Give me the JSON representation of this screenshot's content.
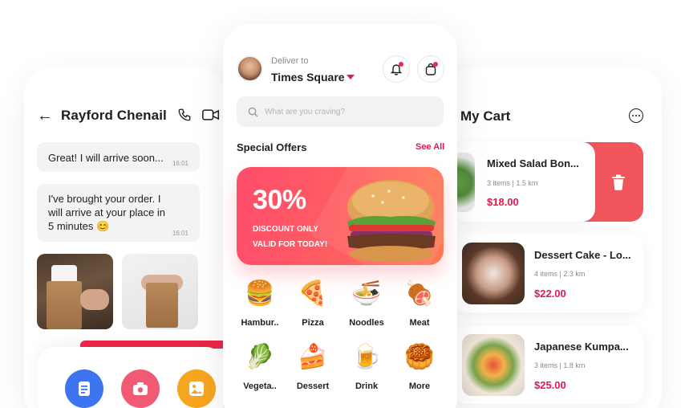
{
  "chat": {
    "contact_name": "Rayford Chenail",
    "messages": [
      {
        "text": "Great! I will arrive soon...",
        "time": "16:01"
      },
      {
        "text": "I've brought your order. I will arrive at your place in 5 minutes 😊",
        "time": "16:01"
      }
    ],
    "icons": {
      "back": "back-arrow-icon",
      "call": "phone-icon",
      "video": "video-camera-icon",
      "doc": "document-icon",
      "camera": "camera-icon",
      "image": "image-icon"
    }
  },
  "home": {
    "deliver_label": "Deliver to",
    "location": "Times Square",
    "search_placeholder": "What are you craving?",
    "offers_title": "Special Offers",
    "see_all": "See All",
    "offer": {
      "percent": "30%",
      "line": "DISCOUNT ONLY VALID FOR TODAY!"
    },
    "categories": [
      {
        "emoji": "🍔",
        "label": "Hambur.."
      },
      {
        "emoji": "🍕",
        "label": "Pizza"
      },
      {
        "emoji": "🍜",
        "label": "Noodles"
      },
      {
        "emoji": "🍖",
        "label": "Meat"
      },
      {
        "emoji": "🥬",
        "label": "Vegeta.."
      },
      {
        "emoji": "🍰",
        "label": "Dessert"
      },
      {
        "emoji": "🍺",
        "label": "Drink"
      },
      {
        "emoji": "🥮",
        "label": "More"
      }
    ]
  },
  "cart": {
    "title": "My Cart",
    "items": [
      {
        "name": "Mixed Salad Bon...",
        "meta": "3 items  |  1.5 km",
        "price": "$18.00"
      },
      {
        "name": "Dessert Cake - Lo...",
        "meta": "4 items  |  2.3 km",
        "price": "$22.00"
      },
      {
        "name": "Japanese Kumpa...",
        "meta": "3 items  |  1.8 km",
        "price": "$25.00"
      }
    ]
  },
  "colors": {
    "accent": "#e5174f",
    "delete": "#f2565d",
    "blue": "#3d74f0",
    "pink": "#f25a74",
    "orange": "#f6a51f"
  }
}
